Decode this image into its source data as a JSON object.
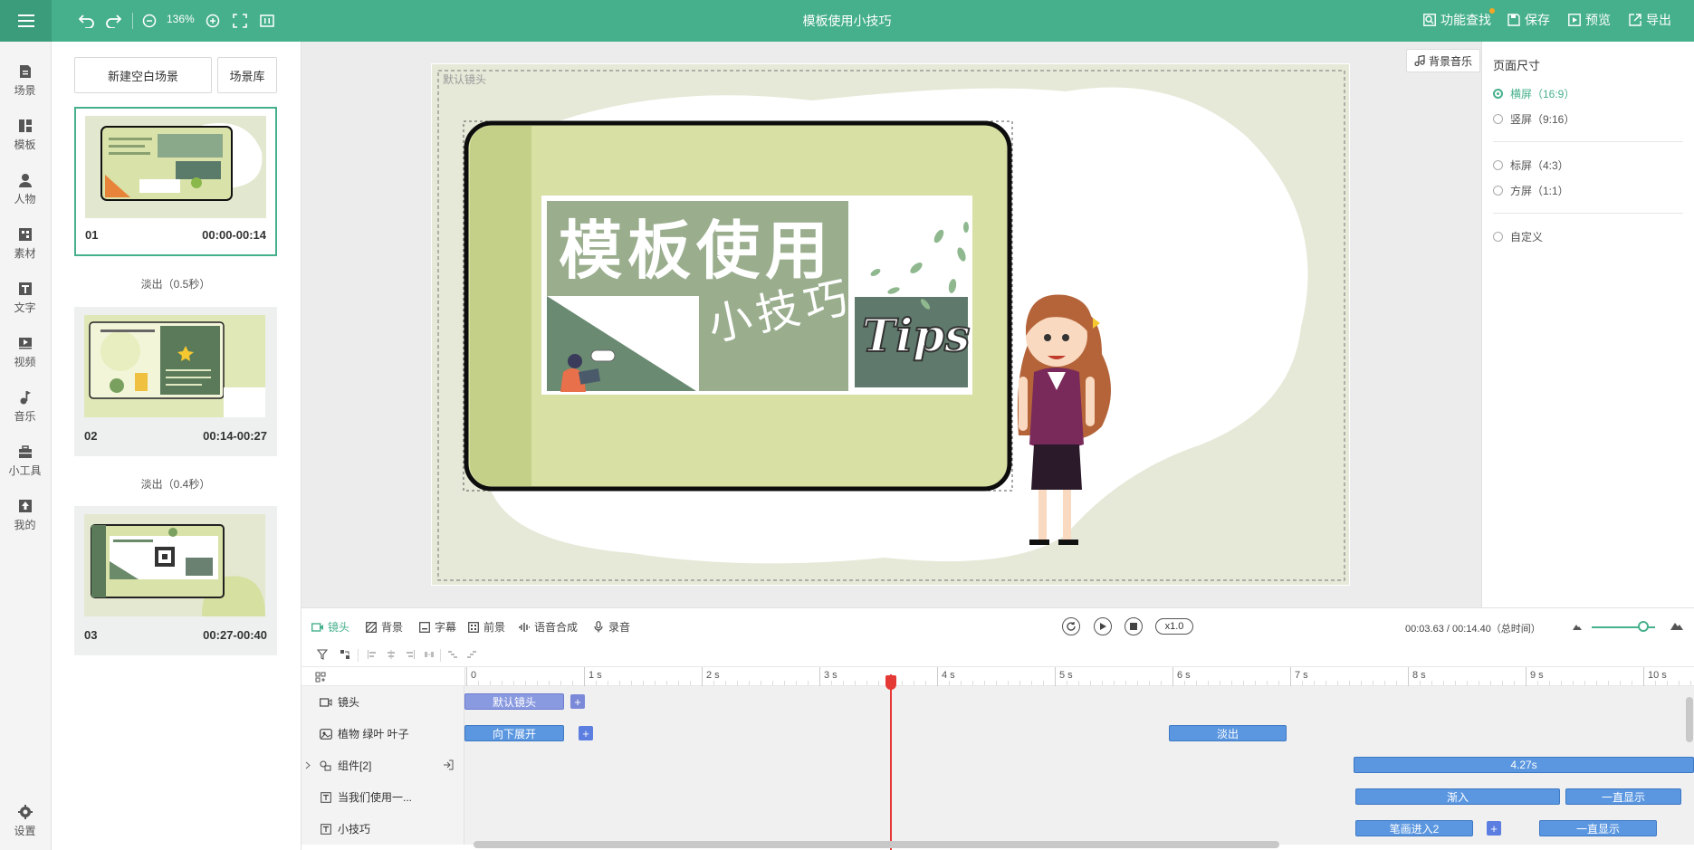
{
  "app": {
    "title": "模板使用小技巧"
  },
  "toolbar": {
    "zoom": "136%",
    "actions": [
      {
        "label": "功能查找",
        "icon": "search-icon"
      },
      {
        "label": "保存",
        "icon": "save-icon"
      },
      {
        "label": "预览",
        "icon": "preview-icon"
      },
      {
        "label": "导出",
        "icon": "export-icon"
      }
    ]
  },
  "sidebar": {
    "items": [
      {
        "label": "场景",
        "icon": "scene-icon"
      },
      {
        "label": "模板",
        "icon": "template-icon"
      },
      {
        "label": "人物",
        "icon": "person-icon"
      },
      {
        "label": "素材",
        "icon": "material-icon"
      },
      {
        "label": "文字",
        "icon": "text-icon"
      },
      {
        "label": "视频",
        "icon": "video-icon"
      },
      {
        "label": "音乐",
        "icon": "music-icon"
      },
      {
        "label": "小工具",
        "icon": "tools-icon"
      },
      {
        "label": "我的",
        "icon": "mine-icon"
      }
    ],
    "settings_label": "设置"
  },
  "scenes": {
    "new_blank_label": "新建空白场景",
    "library_label": "场景库",
    "items": [
      {
        "num": "01",
        "time": "00:00-00:14",
        "transition": "淡出（0.5秒）"
      },
      {
        "num": "02",
        "time": "00:14-00:27",
        "transition": "淡出（0.4秒）"
      },
      {
        "num": "03",
        "time": "00:27-00:40"
      }
    ]
  },
  "canvas": {
    "camera_label": "默认镜头",
    "bg_music_label": "背景音乐",
    "title_text": "模板使用",
    "subtitle_text": "小技巧",
    "tips_text": "Tips"
  },
  "props": {
    "title": "页面尺寸",
    "options": [
      {
        "label": "横屏（16:9）",
        "selected": true
      },
      {
        "label": "竖屏（9:16）",
        "selected": false
      },
      {
        "label": "标屏（4:3）",
        "selected": false
      },
      {
        "label": "方屏（1:1）",
        "selected": false
      },
      {
        "label": "自定义",
        "selected": false
      }
    ]
  },
  "timeline": {
    "tabs": [
      {
        "label": "镜头",
        "icon": "camera-icon"
      },
      {
        "label": "背景",
        "icon": "background-icon"
      },
      {
        "label": "字幕",
        "icon": "subtitle-icon"
      },
      {
        "label": "前景",
        "icon": "foreground-icon"
      },
      {
        "label": "语音合成",
        "icon": "voice-synthesis-icon"
      },
      {
        "label": "录音",
        "icon": "microphone-icon"
      }
    ],
    "speed": "x1.0",
    "time_readout": "00:03.63 / 00:14.40（总时间）",
    "ruler": [
      "0",
      "1 s",
      "2 s",
      "3 s",
      "4 s",
      "5 s",
      "6 s",
      "7 s",
      "8 s",
      "9 s",
      "10 s"
    ],
    "tracks": [
      {
        "label": "镜头",
        "icon": "camera-icon",
        "clips": [
          "默认镜头"
        ]
      },
      {
        "label": "植物 绿叶 叶子",
        "icon": "image-icon",
        "clips": [
          "向下展开",
          "淡出"
        ]
      },
      {
        "label": "组件[2]",
        "icon": "group-icon",
        "clips": [
          "4.27s"
        ]
      },
      {
        "label": "当我们使用一...",
        "icon": "text-icon",
        "clips": [
          "渐入",
          "一直显示"
        ]
      },
      {
        "label": "小技巧",
        "icon": "text-icon",
        "clips": [
          "笔画进入2",
          "一直显示"
        ]
      }
    ]
  },
  "colors": {
    "accent": "#46b08c",
    "clip_blue": "#5b97e0",
    "clip_purple": "#8a9ae0",
    "playhead": "#e53935"
  }
}
